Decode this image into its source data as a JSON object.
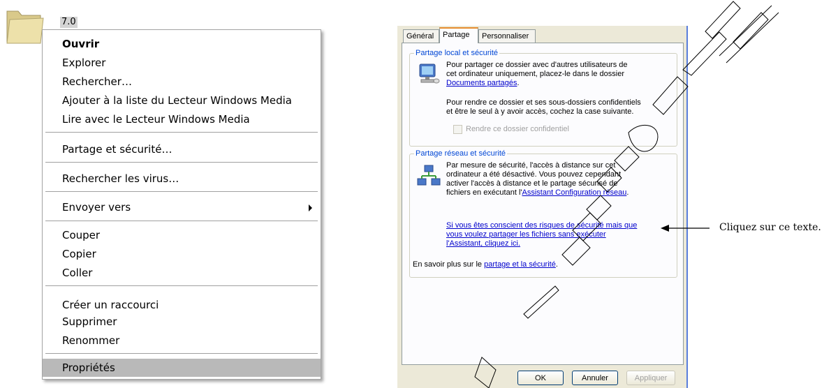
{
  "folder": {
    "icon": "folder-icon",
    "name": "7.0"
  },
  "context_menu": {
    "items": [
      {
        "label": "Ouvrir",
        "bold": true
      },
      {
        "label": "Explorer"
      },
      {
        "label": "Rechercher…"
      },
      {
        "label": "Ajouter à la liste du Lecteur Windows Media"
      },
      {
        "label": "Lire avec le Lecteur Windows Media"
      },
      {
        "label": "Partage et sécurité…"
      },
      {
        "label": "Rechercher les virus…"
      },
      {
        "label": "Envoyer vers",
        "submenu": true
      },
      {
        "label": "Couper"
      },
      {
        "label": "Copier"
      },
      {
        "label": "Coller"
      },
      {
        "label": "Créer un raccourci"
      },
      {
        "label": "Supprimer"
      },
      {
        "label": "Renommer"
      },
      {
        "label": "Propriétés",
        "selected": true
      }
    ]
  },
  "dialog": {
    "tabs": [
      {
        "label": "Général"
      },
      {
        "label": "Partage",
        "active": true
      },
      {
        "label": "Personnaliser"
      }
    ],
    "local_group": {
      "title": "Partage local et sécurité",
      "text1_line1": "Pour partager ce dossier avec d'autres utilisateurs de",
      "text1_line2": "cet ordinateur uniquement, placez-le dans le dossier",
      "link": "Documents partagés",
      "link_suffix": ".",
      "text2_line1": "Pour rendre ce dossier et ses sous-dossiers confidentiels",
      "text2_line2": "et être le seul à y avoir accès, cochez la case suivante.",
      "checkbox_label": "Rendre ce dossier confidentiel"
    },
    "network_group": {
      "title": "Partage réseau et sécurité",
      "line1": "Par mesure de sécurité, l'accès à distance sur cet",
      "line2": "ordinateur a été désactivé. Vous pouvez cependant",
      "line3": "activer l'accès à distance et le partage sécurisé de",
      "line4_prefix": "fichiers en exécutant l'",
      "line4_link": "Assistant Configuration réseau",
      "line4_suffix": ".",
      "warn_link_1": "Si vous êtes conscient des risques de sécurité mais que",
      "warn_link_2": "vous voulez partager les fichiers sans exécuter",
      "warn_link_3": "l'Assistant, cliquez ici."
    },
    "footer_prefix": "En savoir plus sur le ",
    "footer_link": "partage et la sécurité",
    "footer_suffix": ".",
    "buttons": {
      "ok": "OK",
      "cancel": "Annuler",
      "apply": "Appliquer"
    }
  },
  "annotation": {
    "text": "Cliquez sur ce texte."
  },
  "colors": {
    "link": "#0000cc",
    "group_title": "#0046d5",
    "menu_selected": "#b9b9b9"
  }
}
